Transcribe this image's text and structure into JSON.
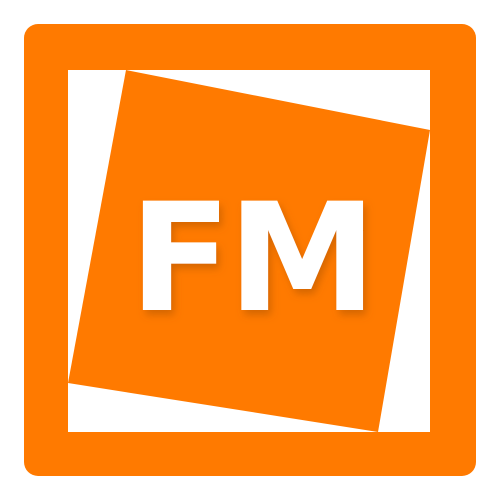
{
  "icon": {
    "name": "fm-app-icon",
    "label": "FM",
    "colors": {
      "accent": "#FF7A00",
      "panel": "#FFFFFF",
      "text": "#FFFFFF",
      "text_shadow": "#B35500"
    }
  }
}
